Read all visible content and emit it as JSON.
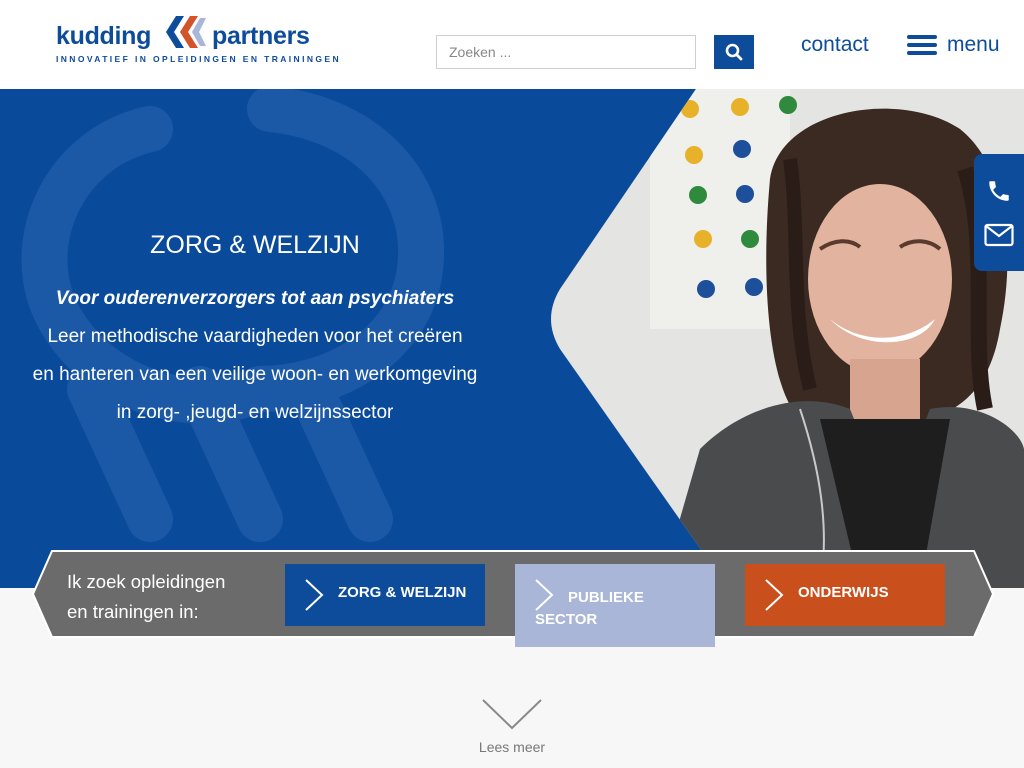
{
  "header": {
    "logo": {
      "word_left": "kudding",
      "word_right": "partners",
      "tagline": "INNOVATIEF IN OPLEIDINGEN EN TRAININGEN"
    },
    "search": {
      "placeholder": "Zoeken ..."
    },
    "contact_label": "contact",
    "menu_label": "menu"
  },
  "hero": {
    "title": "ZORG & WELZIJN",
    "subtitle": "Voor ouderenverzorgers tot aan psychiaters",
    "body_lines": [
      "Leer methodische vaardigheden voor het creëren",
      "en hanteren van een veilige woon- en werkomgeving",
      "in zorg- ,jeugd- en welzijnssector"
    ]
  },
  "side_contact": {
    "icons": [
      "phone-icon",
      "mail-icon"
    ]
  },
  "sector_band": {
    "label_line1": "Ik zoek opleidingen",
    "label_line2": "en trainingen in:",
    "buttons": [
      {
        "label": "ZORG & WELZIJN"
      },
      {
        "label_line1": "PUBLIEKE",
        "label_line2": "SECTOR"
      },
      {
        "label": "ONDERWIJS"
      }
    ]
  },
  "lees_meer": "Lees meer",
  "colors": {
    "brand_blue": "#0d4c9b",
    "hero_blue": "#0a4a9b",
    "publiek": "#a9b6d8",
    "onderwijs": "#c94f1c",
    "band_gray": "#6b6b6b"
  }
}
